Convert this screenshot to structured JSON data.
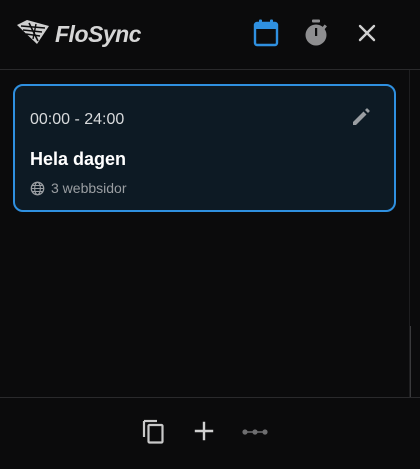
{
  "header": {
    "app_name": "FloSync",
    "calendar_color": "#2f90e0",
    "icons": [
      "logo-icon",
      "calendar-icon",
      "timer-icon",
      "close-icon"
    ]
  },
  "schedule": {
    "time_range": "00:00 - 24:00",
    "title": "Hela dagen",
    "sites": "3 webbsidor",
    "accent": "#2f90e0",
    "icons": [
      "edit-icon",
      "globe-icon"
    ]
  },
  "footer": {
    "icons": [
      "copy-icon",
      "plus-icon",
      "dots-icon"
    ]
  }
}
